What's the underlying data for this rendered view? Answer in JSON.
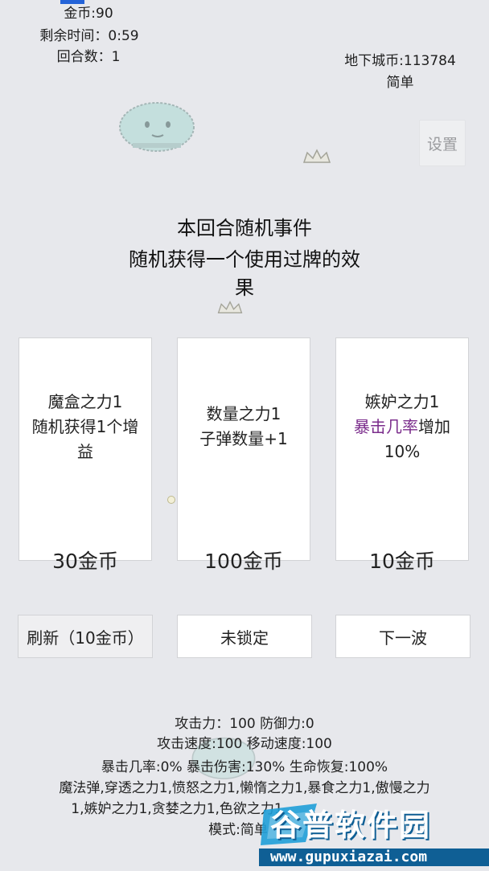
{
  "hud": {
    "gold": "金币:90",
    "time_left": "剩余时间：0:59",
    "round": "回合数：1",
    "dungeon_coins": "地下城币:113784",
    "difficulty": "简单"
  },
  "settings_label": "设置",
  "event": {
    "line1": "本回合随机事件",
    "line2": "随机获得一个使用过牌的效",
    "line3": "果"
  },
  "cards": [
    {
      "name": "魔盒之力1",
      "desc_line1": "随机获得1个增",
      "desc_line2": "益",
      "price": "30金币"
    },
    {
      "name": "数量之力1",
      "desc_line1": "子弹数量+1",
      "price": "100金币"
    },
    {
      "name": "嫉妒之力1",
      "desc_highlight": "暴击几率",
      "desc_rest": "增加",
      "desc_line2": "10%",
      "price": "10金币"
    }
  ],
  "buttons": {
    "refresh": "刷新（10金币）",
    "lock": "未锁定",
    "next_wave": "下一波"
  },
  "stats": {
    "line1": "攻击力：100 防御力:0",
    "line2": "攻击速度:100 移动速度:100",
    "line3": "暴击几率:0% 暴击伤害:130% 生命恢复:100%",
    "line4": "魔法弹,穿透之力1,愤怒之力1,懒惰之力1,暴食之力1,傲慢之力",
    "line5": "1,嫉妒之力1,贪婪之力1,色欲之力1",
    "line6": "模式:简单"
  },
  "watermark": {
    "brand": "谷普软件园",
    "url": "www.gupuxiazai.com"
  },
  "colors": {
    "background": "#e7e8ec",
    "highlight_purple": "#7b2d8c",
    "marker_blue": "#2463d8"
  }
}
